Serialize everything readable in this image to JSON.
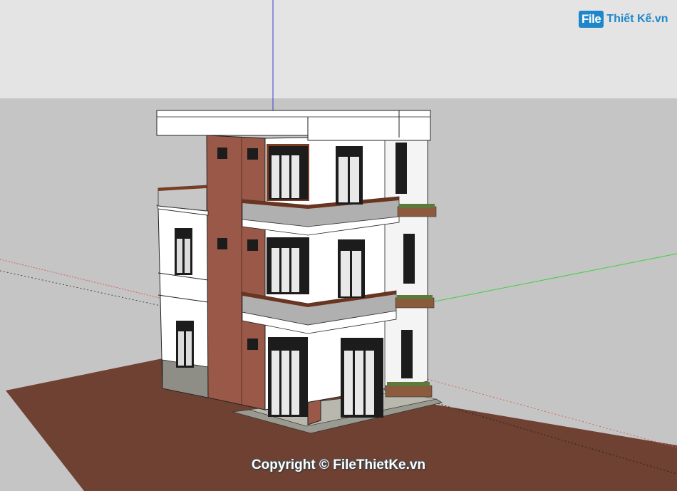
{
  "watermark": {
    "text": "Copyright © FileThietKe.vn"
  },
  "logo": {
    "box": "File",
    "text": "Thiết Kế.vn"
  },
  "colors": {
    "sky": "#e4e4e4",
    "ground": "#c5c5c5",
    "lot": "#6f4133",
    "wall": "#ffffff",
    "brick": "#9a5848",
    "axis_red": "#d96060",
    "axis_green": "#3fcf3f",
    "axis_blue": "#3b3bd6",
    "logo": "#1f87c9"
  },
  "icons": [
    "logo-icon"
  ]
}
